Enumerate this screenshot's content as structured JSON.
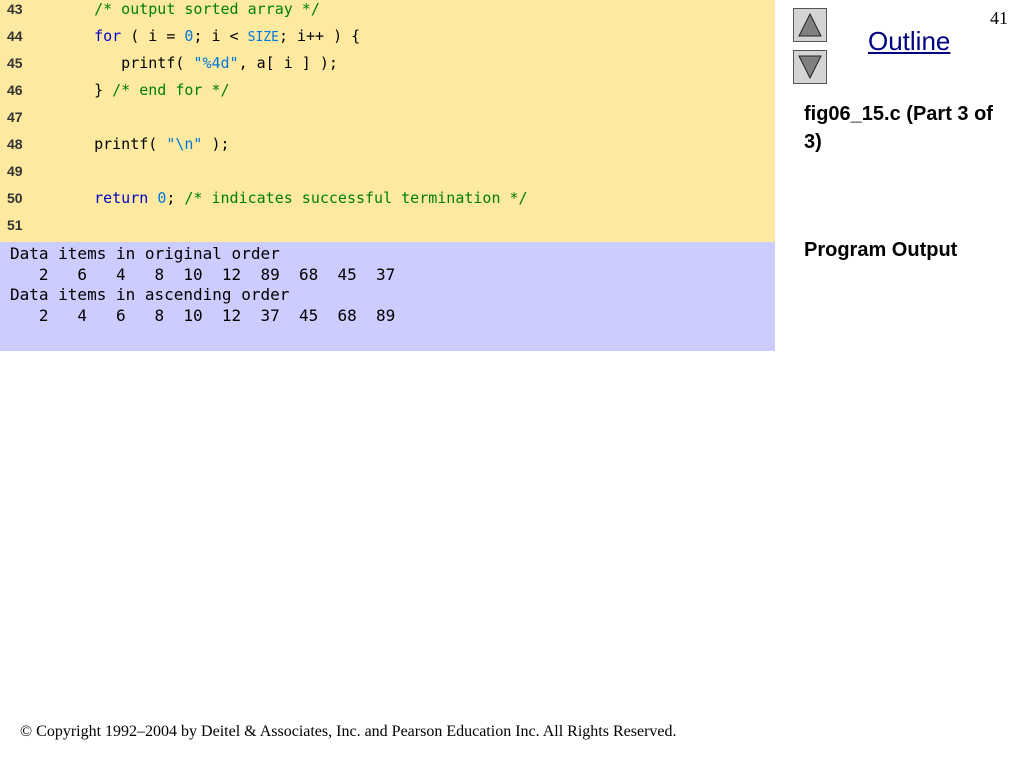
{
  "slide": {
    "page_number": "41",
    "outline_label": "Outline",
    "nav": {
      "up_icon": "triangle-up-icon",
      "down_icon": "triangle-down-icon"
    },
    "file_caption": "fig06_15.c (Part 3 of 3)",
    "output_caption": "Program Output",
    "copyright": "© Copyright 1992–2004 by Deitel & Associates, Inc. and Pearson Education Inc. All Rights Reserved."
  },
  "code": {
    "lines": [
      {
        "num": "43",
        "parts": [
          {
            "t": "   /* output sorted array */",
            "c": "cmt"
          }
        ]
      },
      {
        "num": "44",
        "parts": [
          {
            "t": "   for",
            "c": "kw"
          },
          {
            "t": " ( i = ",
            "c": ""
          },
          {
            "t": "0",
            "c": "num"
          },
          {
            "t": "; i < ",
            "c": ""
          },
          {
            "t": "SIZE",
            "c": "const"
          },
          {
            "t": "; i++ ) {",
            "c": ""
          }
        ]
      },
      {
        "num": "45",
        "parts": [
          {
            "t": "      printf( ",
            "c": ""
          },
          {
            "t": "\"%4d\"",
            "c": "str"
          },
          {
            "t": ", a[ i ] );",
            "c": ""
          }
        ]
      },
      {
        "num": "46",
        "parts": [
          {
            "t": "   } ",
            "c": ""
          },
          {
            "t": "/* end for */",
            "c": "cmt"
          }
        ]
      },
      {
        "num": "47",
        "parts": []
      },
      {
        "num": "48",
        "parts": [
          {
            "t": "   printf( ",
            "c": ""
          },
          {
            "t": "\"\\n\"",
            "c": "str"
          },
          {
            "t": " );",
            "c": ""
          }
        ]
      },
      {
        "num": "49",
        "parts": []
      },
      {
        "num": "50",
        "parts": [
          {
            "t": "   return",
            "c": "kw"
          },
          {
            "t": " ",
            "c": ""
          },
          {
            "t": "0",
            "c": "num"
          },
          {
            "t": "; ",
            "c": ""
          },
          {
            "t": "/* indicates successful termination */",
            "c": "cmt"
          }
        ]
      },
      {
        "num": "51",
        "parts": []
      }
    ]
  },
  "output": {
    "lines": [
      "Data items in original order",
      "   2   6   4   8  10  12  89  68  45  37",
      "Data items in ascending order",
      "   2   4   6   8  10  12  37  45  68  89"
    ]
  },
  "colors": {
    "code_background": "#fde9a0",
    "output_background": "#ccccff",
    "comment": "#008000",
    "keyword": "#0000cc",
    "literal": "#0077dd"
  }
}
